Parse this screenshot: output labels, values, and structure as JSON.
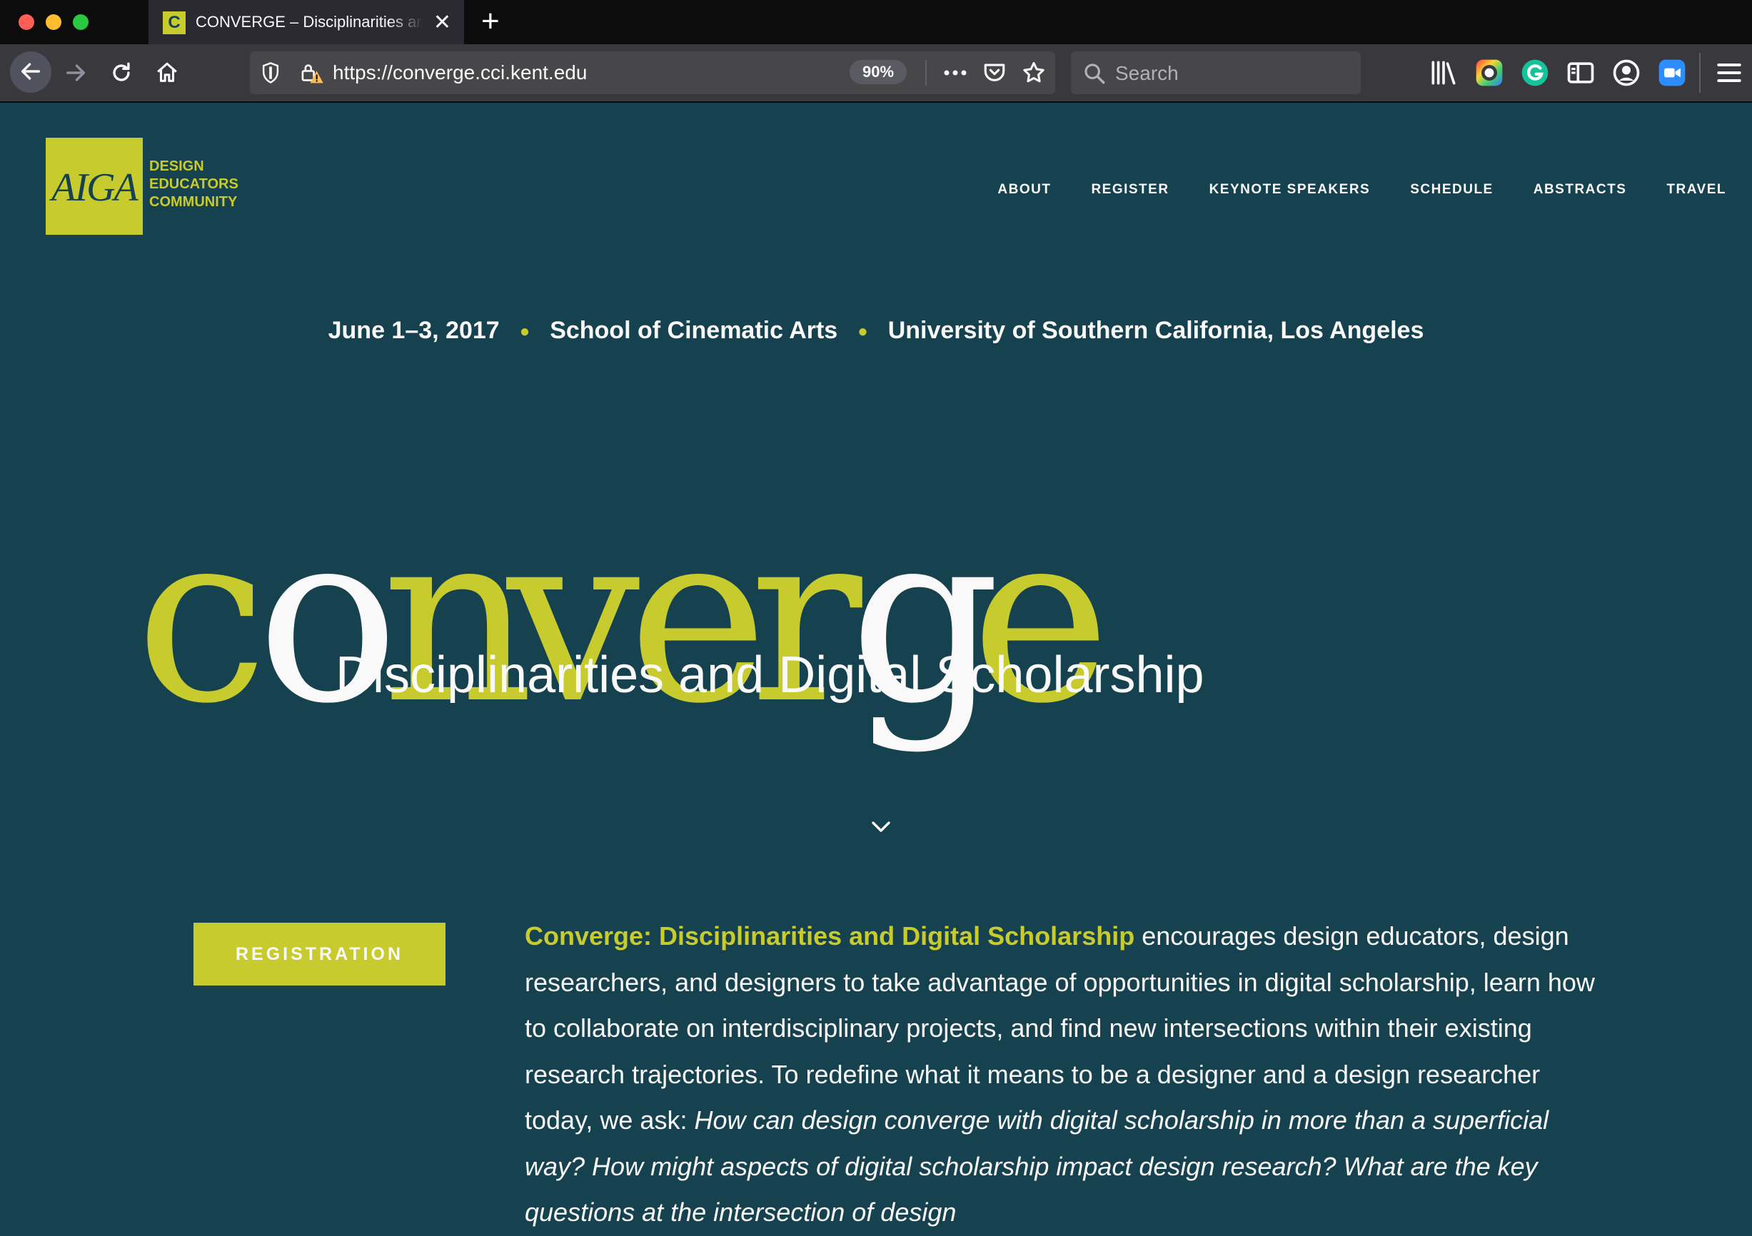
{
  "browser": {
    "tab_title": "CONVERGE – Disciplinarities and Digital Scholarship",
    "favicon_letter": "C",
    "url": "https://converge.cci.kent.edu",
    "zoom": "90%",
    "search_placeholder": "Search",
    "icons": [
      "back-icon",
      "forward-icon",
      "reload-icon",
      "home-icon",
      "shield-icon",
      "lock-warning-icon",
      "more-icon",
      "pocket-icon",
      "star-icon",
      "search-icon",
      "library-icon",
      "colorzilla-icon",
      "grammarly-icon",
      "sidebar-icon",
      "account-icon",
      "zoom-icon",
      "menu-icon"
    ]
  },
  "site": {
    "logo": {
      "mark": "AIGA",
      "lines": [
        "DESIGN",
        "EDUCATORS",
        "COMMUNITY"
      ]
    },
    "nav": [
      "ABOUT",
      "REGISTER",
      "KEYNOTE SPEAKERS",
      "SCHEDULE",
      "ABSTRACTS",
      "TRAVEL"
    ],
    "event": {
      "date": "June 1–3, 2017",
      "venue": "School of Cinematic Arts",
      "place": "University of Southern California, Los Angeles"
    },
    "wordmark": "converge",
    "subtitle": "Disciplinarities and Digital Scholarship",
    "registration_label": "REGISTRATION",
    "intro": {
      "highlight": "Converge: Disciplinarities and Digital Scholarship",
      "body": " encourages design educators, design researchers, and designers to take advantage of opportunities in digital scholarship, learn how to collaborate on interdisciplinary projects, and find new intersections within their existing research trajectories. To redefine what it means to be a designer and a design researcher today, we ask: ",
      "questions": "How can design converge with digital scholarship in more than a superficial way? How might aspects of digital scholarship impact design research? What are the key questions at the intersection of design"
    }
  },
  "colors": {
    "page_bg": "#16424f",
    "accent": "#c8cb2e",
    "text": "#f9f9fa",
    "chrome_dark": "#0c0c0d",
    "chrome_toolbar": "#38383d"
  }
}
